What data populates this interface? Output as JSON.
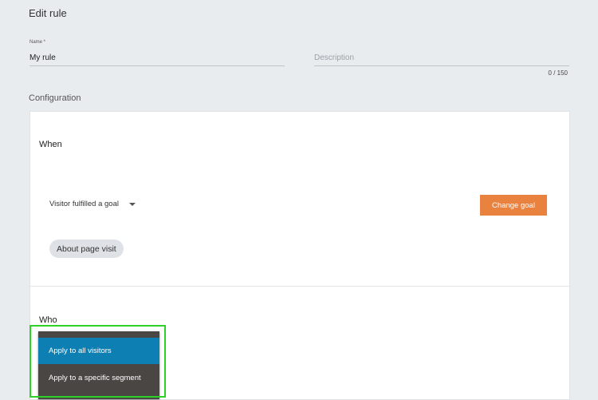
{
  "header": {
    "title": "Edit rule"
  },
  "form": {
    "name_label": "Name *",
    "name_value": "My rule",
    "description_placeholder": "Description",
    "char_count": "0 / 150"
  },
  "configuration": {
    "heading": "Configuration",
    "when": {
      "title": "When",
      "trigger_value": "Visitor fulfilled a goal",
      "change_goal_label": "Change goal",
      "goal_chip": "About page visit"
    },
    "who": {
      "title": "Who",
      "options": [
        "Apply to all visitors",
        "Apply to a specific segment"
      ],
      "selected_index": 0
    }
  },
  "colors": {
    "accent_orange": "#e9813f",
    "selected_blue": "#0e7fb3",
    "menu_dark": "#4a4644",
    "focus_green": "#2dd128"
  }
}
